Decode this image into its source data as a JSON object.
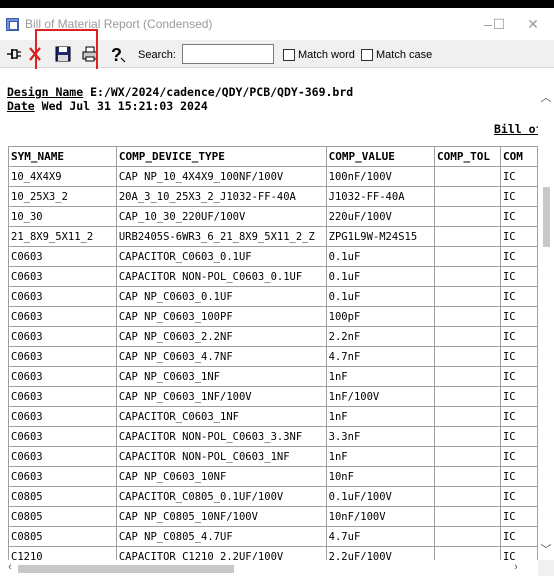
{
  "window": {
    "title": "Bill of Material Report (Condensed)",
    "controls": {
      "minimize": "–",
      "maximize": "☐",
      "close": "✕"
    }
  },
  "toolbar": {
    "search_label": "Search:",
    "search_value": "",
    "match_word_label": "Match word",
    "match_case_label": "Match case"
  },
  "report": {
    "design_label": "Design Name",
    "design_value": "E:/WX/2024/cadence/QDY/PCB/QDY-369.brd",
    "date_label": "Date",
    "date_value": "Wed Jul 31 15:21:03 2024",
    "bill_title": "Bill of"
  },
  "table": {
    "headers": [
      "SYM_NAME",
      "COMP_DEVICE_TYPE",
      "COMP_VALUE",
      "COMP_TOL",
      "COM"
    ],
    "rows": [
      [
        "10_4X4X9",
        "CAP NP_10_4X4X9_100NF/100V",
        "100nF/100V",
        "",
        "IC"
      ],
      [
        "10_25X3_2",
        "20A_3_10_25X3_2_J1032-FF-40A",
        "J1032-FF-40A",
        "",
        "IC"
      ],
      [
        "10_30",
        "CAP_10_30_220UF/100V",
        "220uF/100V",
        "",
        "IC"
      ],
      [
        "21_8X9_5X11_2",
        "URB2405S-6WR3_6_21_8X9_5X11_2_Z",
        "ZPG1L9W-M24S15",
        "",
        "IC"
      ],
      [
        "C0603",
        "CAPACITOR_C0603_0.1UF",
        "0.1uF",
        "",
        "IC"
      ],
      [
        "C0603",
        "CAPACITOR NON-POL_C0603_0.1UF",
        "0.1uF",
        "",
        "IC"
      ],
      [
        "C0603",
        "CAP NP_C0603_0.1UF",
        "0.1uF",
        "",
        "IC"
      ],
      [
        "C0603",
        "CAP NP_C0603_100PF",
        "100pF",
        "",
        "IC"
      ],
      [
        "C0603",
        "CAP NP_C0603_2.2NF",
        "2.2nF",
        "",
        "IC"
      ],
      [
        "C0603",
        "CAP NP_C0603_4.7NF",
        "4.7nF",
        "",
        "IC"
      ],
      [
        "C0603",
        "CAP NP_C0603_1NF",
        "1nF",
        "",
        "IC"
      ],
      [
        "C0603",
        "CAP NP_C0603_1NF/100V",
        "1nF/100V",
        "",
        "IC"
      ],
      [
        "C0603",
        "CAPACITOR_C0603_1NF",
        "1nF",
        "",
        "IC"
      ],
      [
        "C0603",
        "CAPACITOR NON-POL_C0603_3.3NF",
        "3.3nF",
        "",
        "IC"
      ],
      [
        "C0603",
        "CAPACITOR NON-POL_C0603_1NF",
        "1nF",
        "",
        "IC"
      ],
      [
        "C0603",
        "CAP NP_C0603_10NF",
        "10nF",
        "",
        "IC"
      ],
      [
        "C0805",
        "CAPACITOR_C0805_0.1UF/100V",
        "0.1uF/100V",
        "",
        "IC"
      ],
      [
        "C0805",
        "CAP NP_C0805_10NF/100V",
        "10nF/100V",
        "",
        "IC"
      ],
      [
        "C0805",
        "CAP NP_C0805_4.7UF",
        "4.7uF",
        "",
        "IC"
      ],
      [
        "C1210",
        "CAPACITOR_C1210_2.2UF/100V",
        "2.2uF/100V",
        "",
        "IC"
      ]
    ]
  },
  "colors": {
    "highlight_box": "#e02020",
    "title_text": "#9a9a9a",
    "grid": "#a0a0a0"
  },
  "icons": [
    "app-icon",
    "pin-icon",
    "close-icon",
    "save-icon",
    "print-icon",
    "help-icon"
  ]
}
